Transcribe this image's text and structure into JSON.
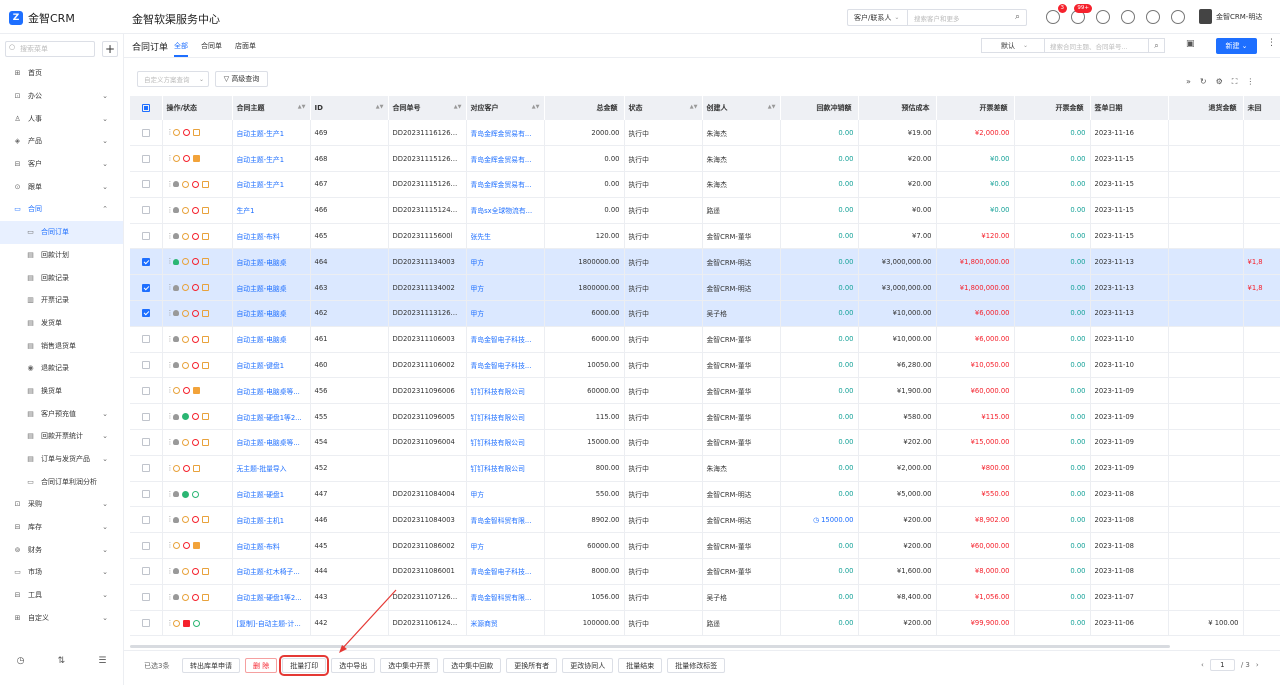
{
  "brand": {
    "logo_glyph": "Z",
    "name": "金智CRM",
    "app_title": "金智软渠服务中心"
  },
  "top": {
    "search_type": "客户/联系人",
    "search_placeholder": "搜索客户和更多",
    "badge1": "3",
    "badge2": "99+",
    "user": "金智CRM-明达"
  },
  "sidebar": {
    "search_placeholder": "搜索菜单",
    "items": [
      {
        "label": "首页",
        "icon": "⊞",
        "chevron": ""
      },
      {
        "label": "办公",
        "icon": "⊡",
        "chevron": "⌄"
      },
      {
        "label": "人事",
        "icon": "♙",
        "chevron": "⌄"
      },
      {
        "label": "产品",
        "icon": "◈",
        "chevron": "⌄"
      },
      {
        "label": "客户",
        "icon": "⊟",
        "chevron": "⌄"
      },
      {
        "label": "跟单",
        "icon": "⊙",
        "chevron": "⌄"
      },
      {
        "label": "合同",
        "icon": "▭",
        "chevron": "⌃"
      },
      {
        "label": "合同订单",
        "icon": "▭",
        "chevron": ""
      },
      {
        "label": "回款计划",
        "icon": "▤",
        "chevron": ""
      },
      {
        "label": "回款记录",
        "icon": "▤",
        "chevron": ""
      },
      {
        "label": "开票记录",
        "icon": "▥",
        "chevron": ""
      },
      {
        "label": "发货单",
        "icon": "▤",
        "chevron": ""
      },
      {
        "label": "销售退货单",
        "icon": "▤",
        "chevron": ""
      },
      {
        "label": "退款记录",
        "icon": "◉",
        "chevron": ""
      },
      {
        "label": "换货单",
        "icon": "▤",
        "chevron": ""
      },
      {
        "label": "客户预充值",
        "icon": "▤",
        "chevron": "⌄"
      },
      {
        "label": "回款开票统计",
        "icon": "▤",
        "chevron": "⌄"
      },
      {
        "label": "订单与发货产品",
        "icon": "▤",
        "chevron": "⌄"
      },
      {
        "label": "合同订单利润分析",
        "icon": "▭",
        "chevron": ""
      },
      {
        "label": "采购",
        "icon": "⊡",
        "chevron": "⌄"
      },
      {
        "label": "库存",
        "icon": "⊟",
        "chevron": "⌄"
      },
      {
        "label": "财务",
        "icon": "⊚",
        "chevron": "⌄"
      },
      {
        "label": "市场",
        "icon": "▭",
        "chevron": "⌄"
      },
      {
        "label": "工具",
        "icon": "⊟",
        "chevron": "⌄"
      },
      {
        "label": "自定义",
        "icon": "⊞",
        "chevron": "⌄"
      }
    ],
    "foot": [
      "◷",
      "⇅",
      "☰"
    ]
  },
  "page": {
    "title": "合同订单",
    "tabs": [
      "全部",
      "合同单",
      "店面单"
    ],
    "sort": "默认",
    "search_placeholder": "搜索合同主题、合同单号...",
    "new_btn": "新建",
    "filter_placeholder": "自定义方案查询",
    "advanced": "高级查询"
  },
  "table": {
    "headers": [
      "",
      "操作/状态",
      "合同主题",
      "ID",
      "合同单号",
      "对应客户",
      "总金额",
      "状态",
      "创建人",
      "回款冲销额",
      "预估成本",
      "开票差额",
      "开票金额",
      "签单日期",
      "退货金额",
      "未回"
    ],
    "rows": [
      {
        "sel": false,
        "ops": "a",
        "subject": "自动主题-生产1",
        "id": "469",
        "no": "DD202311161268001",
        "cust": "青岛金辉金贸易有...",
        "total": "2000.00",
        "status": "执行中",
        "creator": "朱海杰",
        "ret": "0.00",
        "cost": "¥19.00",
        "diff": "¥2,000.00",
        "diffc": "red",
        "inv": "0.00",
        "date": "2023-11-16",
        "refund": "",
        "rest": ""
      },
      {
        "sel": false,
        "ops": "b",
        "subject": "自动主题-生产1",
        "id": "468",
        "no": "DD202311151268004",
        "cust": "青岛金辉金贸易有...",
        "total": "0.00",
        "status": "执行中",
        "creator": "朱海杰",
        "ret": "0.00",
        "cost": "¥20.00",
        "diff": "¥0.00",
        "diffc": "green",
        "inv": "0.00",
        "date": "2023-11-15",
        "refund": "",
        "rest": ""
      },
      {
        "sel": false,
        "ops": "c",
        "subject": "自动主题-生产1",
        "id": "467",
        "no": "DD202311151268003",
        "cust": "青岛金辉金贸易有...",
        "total": "0.00",
        "status": "执行中",
        "creator": "朱海杰",
        "ret": "0.00",
        "cost": "¥20.00",
        "diff": "¥0.00",
        "diffc": "green",
        "inv": "0.00",
        "date": "2023-11-15",
        "refund": "",
        "rest": ""
      },
      {
        "sel": false,
        "ops": "c",
        "subject": "生产1",
        "id": "466",
        "no": "DD202311151244002",
        "cust": "青岛sx全球物流有...",
        "total": "0.00",
        "status": "执行中",
        "creator": "路遥",
        "ret": "0.00",
        "cost": "¥0.00",
        "diff": "¥0.00",
        "diffc": "green",
        "inv": "0.00",
        "date": "2023-11-15",
        "refund": "",
        "rest": ""
      },
      {
        "sel": false,
        "ops": "c",
        "subject": "自动主题-布料",
        "id": "465",
        "no": "DD20231115600l",
        "cust": "张先生",
        "total": "120.00",
        "status": "执行中",
        "creator": "金智CRM-董华",
        "ret": "0.00",
        "cost": "¥7.00",
        "diff": "¥120.00",
        "diffc": "red",
        "inv": "0.00",
        "date": "2023-11-15",
        "refund": "",
        "rest": ""
      },
      {
        "sel": true,
        "ops": "g",
        "subject": "自动主题-电脑桌",
        "id": "464",
        "no": "DD202311134003",
        "cust": "甲方",
        "total": "1800000.00",
        "status": "执行中",
        "creator": "金智CRM-明达",
        "ret": "0.00",
        "cost": "¥3,000,000.00",
        "diff": "¥1,800,000.00",
        "diffc": "red",
        "inv": "0.00",
        "date": "2023-11-13",
        "refund": "",
        "rest": "¥1,8"
      },
      {
        "sel": true,
        "ops": "c",
        "subject": "自动主题-电脑桌",
        "id": "463",
        "no": "DD202311134002",
        "cust": "甲方",
        "total": "1800000.00",
        "status": "执行中",
        "creator": "金智CRM-明达",
        "ret": "0.00",
        "cost": "¥3,000,000.00",
        "diff": "¥1,800,000.00",
        "diffc": "red",
        "inv": "0.00",
        "date": "2023-11-13",
        "refund": "",
        "rest": "¥1,8"
      },
      {
        "sel": true,
        "ops": "c",
        "subject": "自动主题-电脑桌",
        "id": "462",
        "no": "DD202311131266001",
        "cust": "甲方",
        "total": "6000.00",
        "status": "执行中",
        "creator": "吴子格",
        "ret": "0.00",
        "cost": "¥10,000.00",
        "diff": "¥6,000.00",
        "diffc": "red",
        "inv": "0.00",
        "date": "2023-11-13",
        "refund": "",
        "rest": ""
      },
      {
        "sel": false,
        "ops": "c",
        "subject": "自动主题-电脑桌",
        "id": "461",
        "no": "DD202311106003",
        "cust": "青岛金智电子科技...",
        "total": "6000.00",
        "status": "执行中",
        "creator": "金智CRM-董华",
        "ret": "0.00",
        "cost": "¥10,000.00",
        "diff": "¥6,000.00",
        "diffc": "red",
        "inv": "0.00",
        "date": "2023-11-10",
        "refund": "",
        "rest": ""
      },
      {
        "sel": false,
        "ops": "c",
        "subject": "自动主题-键盘1",
        "id": "460",
        "no": "DD202311106002",
        "cust": "青岛金智电子科技...",
        "total": "10050.00",
        "status": "执行中",
        "creator": "金智CRM-董华",
        "ret": "0.00",
        "cost": "¥6,280.00",
        "diff": "¥10,050.00",
        "diffc": "red",
        "inv": "0.00",
        "date": "2023-11-10",
        "refund": "",
        "rest": ""
      },
      {
        "sel": false,
        "ops": "d",
        "subject": "自动主题-电脑桌等...",
        "id": "456",
        "no": "DD202311096006",
        "cust": "钉钉科技有限公司",
        "total": "60000.00",
        "status": "执行中",
        "creator": "金智CRM-董华",
        "ret": "0.00",
        "cost": "¥1,900.00",
        "diff": "¥60,000.00",
        "diffc": "red",
        "inv": "0.00",
        "date": "2023-11-09",
        "refund": "",
        "rest": ""
      },
      {
        "sel": false,
        "ops": "e",
        "subject": "自动主题-硬盘1等2...",
        "id": "455",
        "no": "DD202311096005",
        "cust": "钉钉科技有限公司",
        "total": "115.00",
        "status": "执行中",
        "creator": "金智CRM-董华",
        "ret": "0.00",
        "cost": "¥580.00",
        "diff": "¥115.00",
        "diffc": "red",
        "inv": "0.00",
        "date": "2023-11-09",
        "refund": "",
        "rest": ""
      },
      {
        "sel": false,
        "ops": "c",
        "subject": "自动主题-电脑桌等...",
        "id": "454",
        "no": "DD202311096004",
        "cust": "钉钉科技有限公司",
        "total": "15000.00",
        "status": "执行中",
        "creator": "金智CRM-董华",
        "ret": "0.00",
        "cost": "¥202.00",
        "diff": "¥15,000.00",
        "diffc": "red",
        "inv": "0.00",
        "date": "2023-11-09",
        "refund": "",
        "rest": ""
      },
      {
        "sel": false,
        "ops": "a",
        "subject": "无主题-批量导入",
        "id": "452",
        "no": "",
        "cust": "钉钉科技有限公司",
        "total": "800.00",
        "status": "执行中",
        "creator": "朱海杰",
        "ret": "0.00",
        "cost": "¥2,000.00",
        "diff": "¥800.00",
        "diffc": "red",
        "inv": "0.00",
        "date": "2023-11-09",
        "refund": "",
        "rest": ""
      },
      {
        "sel": false,
        "ops": "f",
        "subject": "自动主题-硬盘1",
        "id": "447",
        "no": "DD202311084004",
        "cust": "甲方",
        "total": "550.00",
        "status": "执行中",
        "creator": "金智CRM-明达",
        "ret": "0.00",
        "cost": "¥5,000.00",
        "diff": "¥550.00",
        "diffc": "red",
        "inv": "0.00",
        "date": "2023-11-08",
        "refund": "",
        "rest": ""
      },
      {
        "sel": false,
        "ops": "c",
        "subject": "自动主题-主机1",
        "id": "446",
        "no": "DD202311084003",
        "cust": "青岛金智科贸有限...",
        "total": "8902.00",
        "status": "执行中",
        "creator": "金智CRM-明达",
        "ret": "15000.00",
        "cost": "¥200.00",
        "diff": "¥8,902.00",
        "diffc": "red",
        "inv": "0.00",
        "date": "2023-11-08",
        "refund": "",
        "rest": "",
        "clock": true
      },
      {
        "sel": false,
        "ops": "d",
        "subject": "自动主题-布料",
        "id": "445",
        "no": "DD202311086002",
        "cust": "甲方",
        "total": "60000.00",
        "status": "执行中",
        "creator": "金智CRM-董华",
        "ret": "0.00",
        "cost": "¥200.00",
        "diff": "¥60,000.00",
        "diffc": "red",
        "inv": "0.00",
        "date": "2023-11-08",
        "refund": "",
        "rest": ""
      },
      {
        "sel": false,
        "ops": "c",
        "subject": "自动主题-红木椅子...",
        "id": "444",
        "no": "DD202311086001",
        "cust": "青岛金智电子科技...",
        "total": "8000.00",
        "status": "执行中",
        "creator": "金智CRM-董华",
        "ret": "0.00",
        "cost": "¥1,600.00",
        "diff": "¥8,000.00",
        "diffc": "red",
        "inv": "0.00",
        "date": "2023-11-08",
        "refund": "",
        "rest": ""
      },
      {
        "sel": false,
        "ops": "c",
        "subject": "自动主题-硬盘1等2...",
        "id": "443",
        "no": "DD202311071266001",
        "cust": "青岛金智科贸有限...",
        "total": "1056.00",
        "status": "执行中",
        "creator": "吴子格",
        "ret": "0.00",
        "cost": "¥8,400.00",
        "diff": "¥1,056.00",
        "diffc": "red",
        "inv": "0.00",
        "date": "2023-11-07",
        "refund": "",
        "rest": ""
      },
      {
        "sel": false,
        "ops": "h",
        "subject": "[复制]-自动主题-计...",
        "id": "442",
        "no": "DD202311061244001",
        "cust": "米源商贸",
        "total": "100000.00",
        "status": "执行中",
        "creator": "路遥",
        "ret": "0.00",
        "cost": "¥200.00",
        "diff": "¥99,900.00",
        "diffc": "red",
        "inv": "0.00",
        "date": "2023-11-06",
        "refund": "¥ 100.00",
        "rest": ""
      }
    ]
  },
  "footer": {
    "selected": "已选3条",
    "buttons": [
      "转出库单申请",
      "删 除",
      "批量打印",
      "选中导出",
      "选中集中开票",
      "选中集中回款",
      "更换所有者",
      "更改协同人",
      "批量结束",
      "批量修改标签"
    ],
    "page": "1",
    "total_pages": "/ 3",
    "prev": "‹",
    "next": "›"
  }
}
